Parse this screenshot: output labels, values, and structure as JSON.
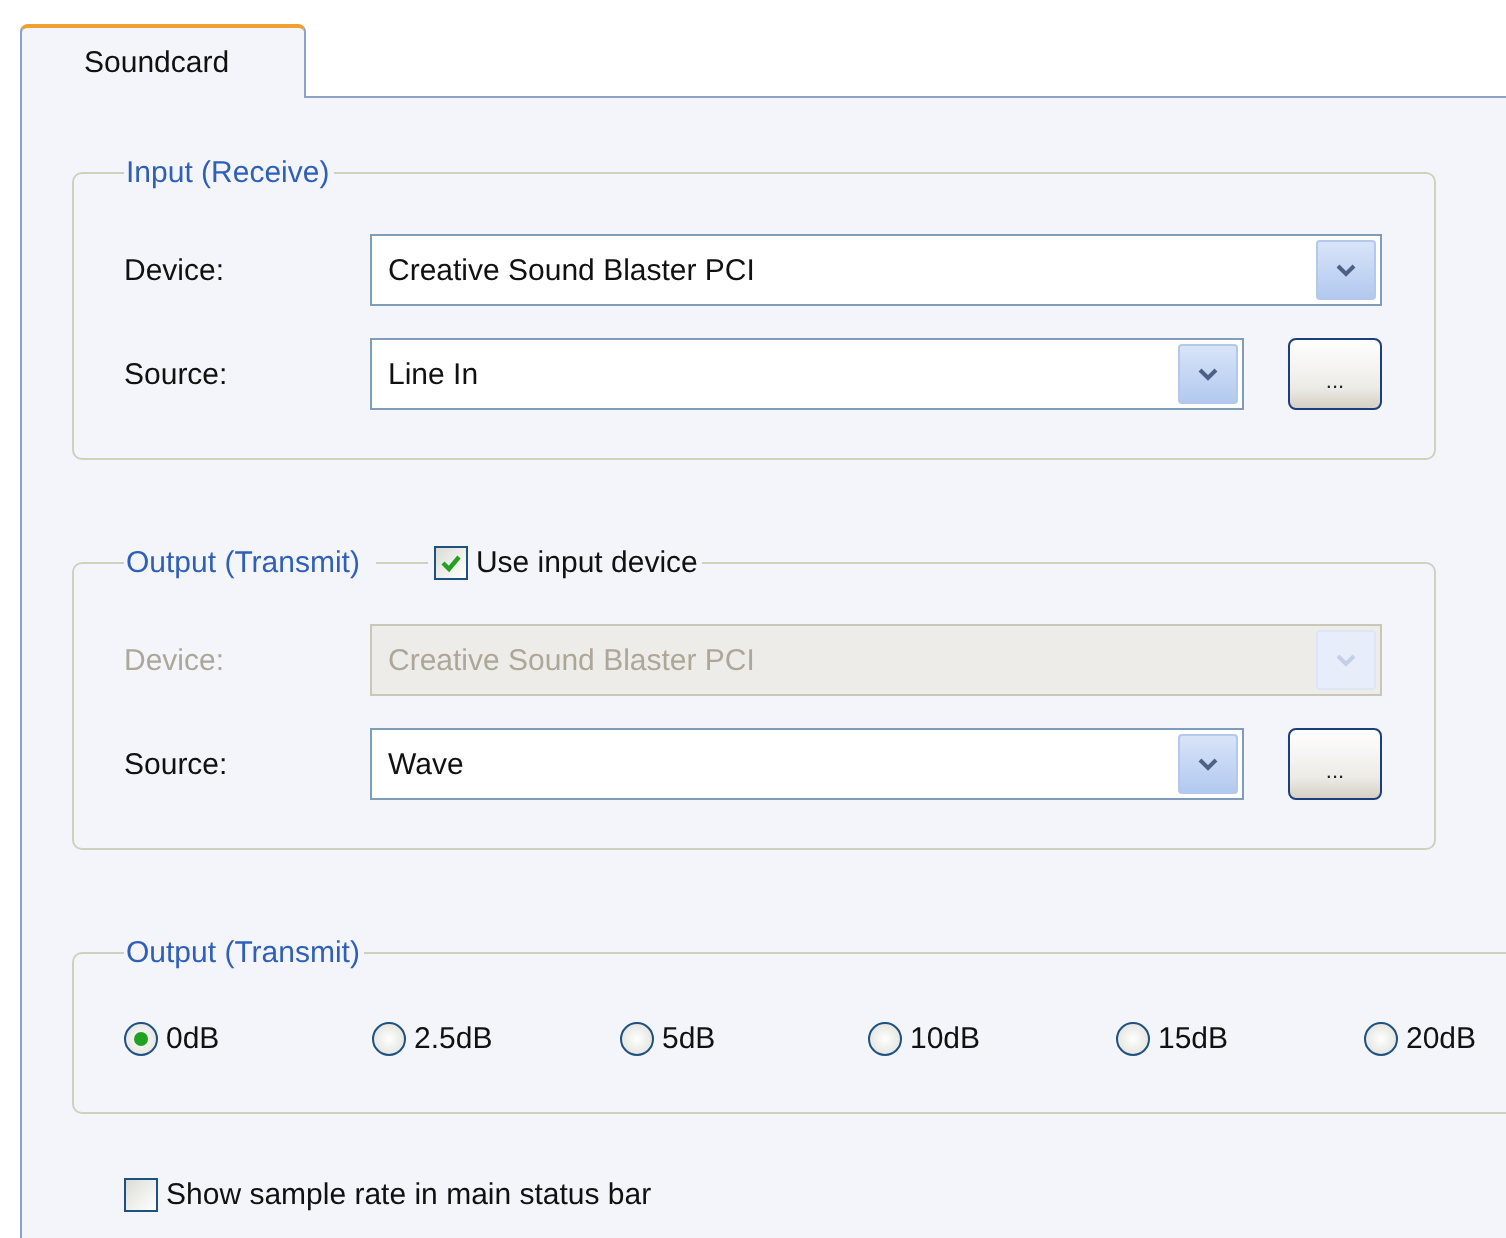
{
  "tabs": [
    {
      "label": "Soundcard",
      "selected": true
    }
  ],
  "groups": [
    {
      "title": "Input (Receive)",
      "rows": [
        {
          "label": "Device:",
          "value": "Creative Sound Blaster PCI",
          "disabled": false
        },
        {
          "label": "Source:",
          "value": "Line In",
          "disabled": false,
          "button": "..."
        }
      ]
    },
    {
      "title": "Output (Transmit)",
      "option": {
        "label": "Use input device",
        "checked": true
      },
      "rows": [
        {
          "label": "Device:",
          "value": "Creative Sound Blaster PCI",
          "disabled": true
        },
        {
          "label": "Source:",
          "value": "Wave",
          "disabled": false,
          "button": "..."
        }
      ]
    }
  ],
  "gain": {
    "title": "Output (Transmit)",
    "options": [
      {
        "label": "0dB",
        "selected": true
      },
      {
        "label": "2.5dB",
        "selected": false
      },
      {
        "label": "5dB",
        "selected": false
      },
      {
        "label": "10dB",
        "selected": false
      },
      {
        "label": "15dB",
        "selected": false
      },
      {
        "label": "20dB",
        "selected": false
      }
    ]
  },
  "show_sample_rate": {
    "label": "Show sample rate in main status bar",
    "checked": false
  }
}
